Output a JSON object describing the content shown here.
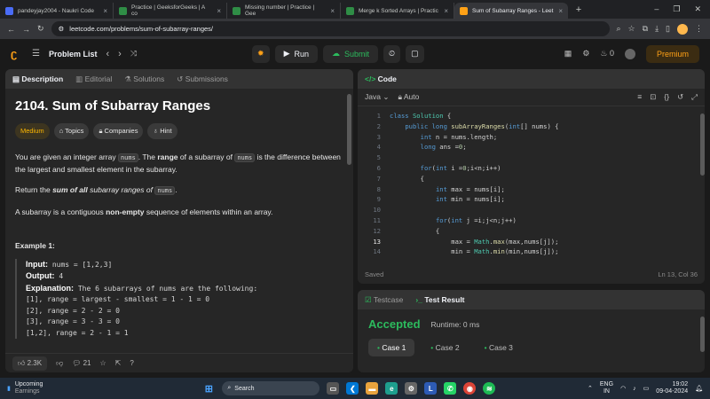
{
  "browser": {
    "tabs": [
      {
        "title": "pandeyjay2004 - Naukri Code",
        "color": "#4a6cf7"
      },
      {
        "title": "Practice | GeeksforGeeks | A co",
        "color": "#2f8d46"
      },
      {
        "title": "Missing number | Practice | Gee",
        "color": "#2f8d46"
      },
      {
        "title": "Merge k Sorted Arrays | Practic",
        "color": "#2f8d46"
      },
      {
        "title": "Sum of Subarray Ranges - Leet",
        "color": "#ffa116"
      }
    ],
    "url": "leetcode.com/problems/sum-of-subarray-ranges/"
  },
  "lc_header": {
    "problem_list": "Problem List",
    "run": "Run",
    "submit": "Submit",
    "streak": "0",
    "premium": "Premium"
  },
  "left_tabs": [
    "Description",
    "Editorial",
    "Solutions",
    "Submissions"
  ],
  "problem": {
    "title": "2104. Sum of Subarray Ranges",
    "difficulty": "Medium",
    "chips": [
      "Topics",
      "Companies",
      "Hint"
    ],
    "p1": {
      "a": "You are given an integer array ",
      "code1": "nums",
      "b": ". The ",
      "bold": "range",
      "c": " of a subarray of ",
      "code2": "nums",
      "d": " is the difference between the largest and smallest element in the subarray."
    },
    "p2": {
      "a": "Return the ",
      "bi": "sum of all",
      "b": " subarray ranges of ",
      "code": "nums",
      "c": "."
    },
    "p3": {
      "a": "A subarray is a contiguous ",
      "bold": "non-empty",
      "b": " sequence of elements within an array."
    },
    "example_title": "Example 1:",
    "ex_input_label": "Input:",
    "ex_input": "nums = [1,2,3]",
    "ex_output_label": "Output:",
    "ex_output": "4",
    "ex_expl_label": "Explanation:",
    "ex_expl": "The 6 subarrays of nums are the following:",
    "ex_lines": [
      "[1], range = largest - smallest = 1 - 1 = 0",
      "[2], range = 2 - 2 = 0",
      "[3], range = 3 - 3 = 0",
      "[1,2], range = 2 - 1 = 1"
    ]
  },
  "left_footer": {
    "likes": "2.3K",
    "comments": "21"
  },
  "code_panel": {
    "title": "Code",
    "lang": "Java",
    "mode": "Auto",
    "saved": "Saved",
    "cursor": "Ln 13, Col 36",
    "lines": [
      {
        "n": "1",
        "html": "<span class='kw'>class</span> <span class='ty'>Solution</span> {"
      },
      {
        "n": "2",
        "html": "    <span class='kw'>public long</span> <span class='fn'>subArrayRanges</span>(<span class='kw'>int</span>[] nums) {"
      },
      {
        "n": "3",
        "html": "        <span class='kw'>int</span> n = nums.length;"
      },
      {
        "n": "4",
        "html": "        <span class='kw'>long</span> ans =<span class='num'>0</span>;"
      },
      {
        "n": "5",
        "html": ""
      },
      {
        "n": "6",
        "html": "        <span class='kw'>for</span>(<span class='kw'>int</span> i =<span class='num'>0</span>;i&lt;n;i++)"
      },
      {
        "n": "7",
        "html": "        {"
      },
      {
        "n": "8",
        "html": "            <span class='kw'>int</span> max = nums[i];"
      },
      {
        "n": "9",
        "html": "            <span class='kw'>int</span> min = nums[i];"
      },
      {
        "n": "10",
        "html": ""
      },
      {
        "n": "11",
        "html": "            <span class='kw'>for</span>(<span class='kw'>int</span> j =i;j&lt;n;j++)"
      },
      {
        "n": "12",
        "html": "            {"
      },
      {
        "n": "13",
        "html": "                max = <span class='ty'>Math</span>.<span class='fn'>max</span>(max,nums[j]);"
      },
      {
        "n": "14",
        "html": "                min = <span class='ty'>Math</span>.<span class='fn'>min</span>(min,nums[j]);"
      }
    ]
  },
  "result_panel": {
    "tabs": [
      "Testcase",
      "Test Result"
    ],
    "status": "Accepted",
    "runtime": "Runtime: 0 ms",
    "cases": [
      "Case 1",
      "Case 2",
      "Case 3"
    ]
  },
  "taskbar": {
    "weather_title": "Upcoming",
    "weather_sub": "Earnings",
    "search": "Search",
    "lang1": "ENG",
    "lang2": "IN",
    "time": "19:02",
    "date": "09-04-2024"
  }
}
